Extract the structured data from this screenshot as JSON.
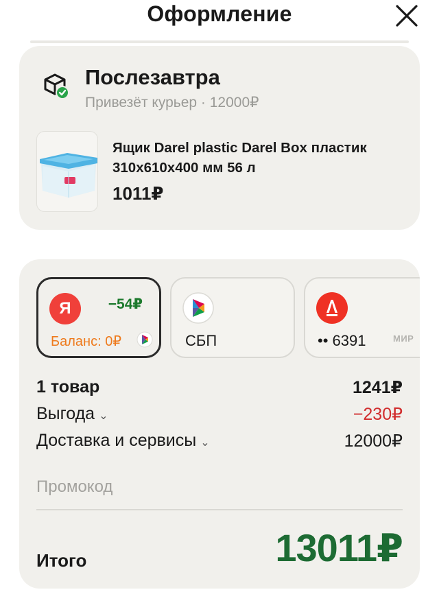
{
  "header": {
    "title": "Оформление"
  },
  "delivery": {
    "title": "Послезавтра",
    "subtitle": "Привезёт курьер · 12000₽",
    "product": {
      "name": "Ящик Darel plastic Darel Box пластик 310x610x400 мм 56 л",
      "price": "1011₽"
    }
  },
  "payment": {
    "methods": [
      {
        "icon": "yandex-pay-icon",
        "letter": "Я",
        "discount": "−54₽",
        "balance": "Баланс: 0₽",
        "selected": true
      },
      {
        "icon": "sbp-icon",
        "label": "СБП",
        "selected": false
      },
      {
        "icon": "alfa-bank-icon",
        "number": "•• 6391",
        "network": "МИР",
        "selected": false
      }
    ]
  },
  "summary": {
    "items_label": "1 товар",
    "items_value": "1241₽",
    "benefit_label": "Выгода",
    "benefit_value": "−230₽",
    "delivery_label": "Доставка и сервисы",
    "delivery_value": "12000₽"
  },
  "promo": {
    "placeholder": "Промокод"
  },
  "total": {
    "label": "Итого",
    "value": "13011₽"
  },
  "colors": {
    "accent_green": "#1d6b33",
    "discount_red": "#d12d2d",
    "balance_orange": "#ee7a1c",
    "card_bg": "#f1f0ec"
  }
}
